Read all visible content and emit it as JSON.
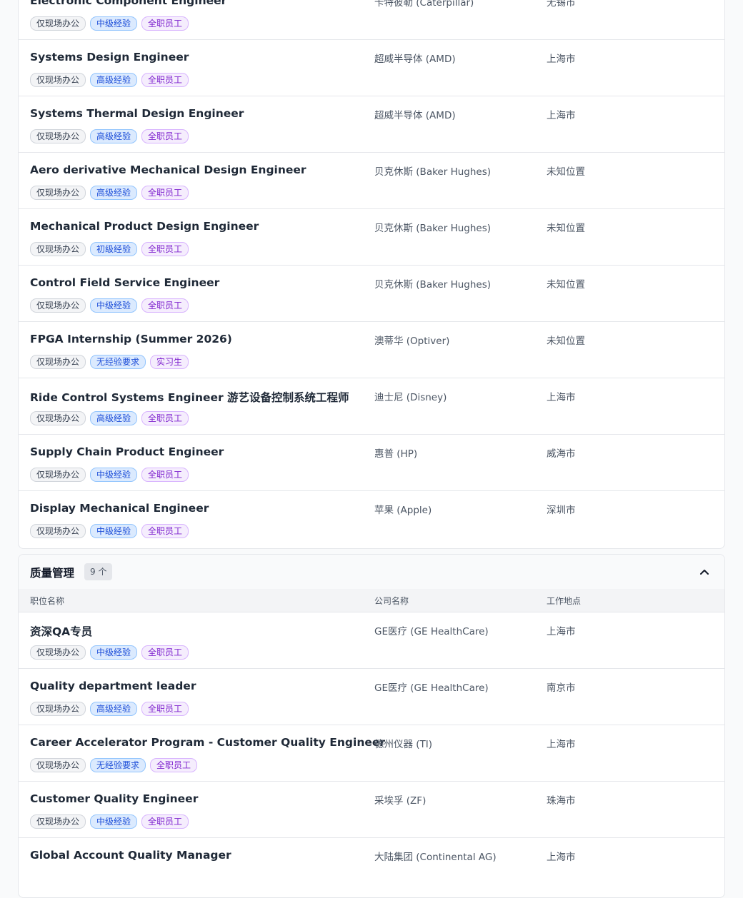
{
  "section_1": {
    "rows": [
      {
        "title": "Electronic Component Engineer",
        "company": "卡特彼勒 (Caterpillar)",
        "location": "无锡市",
        "tags": [
          "仅现场办公",
          "中级经验",
          "全职员工"
        ]
      },
      {
        "title": "Systems Design Engineer",
        "company": "超威半导体 (AMD)",
        "location": "上海市",
        "tags": [
          "仅现场办公",
          "高级经验",
          "全职员工"
        ]
      },
      {
        "title": "Systems Thermal Design Engineer",
        "company": "超威半导体 (AMD)",
        "location": "上海市",
        "tags": [
          "仅现场办公",
          "高级经验",
          "全职员工"
        ]
      },
      {
        "title": "Aero derivative Mechanical Design Engineer",
        "company": "贝克休斯 (Baker Hughes)",
        "location": "未知位置",
        "tags": [
          "仅现场办公",
          "高级经验",
          "全职员工"
        ]
      },
      {
        "title": "Mechanical Product Design Engineer",
        "company": "贝克休斯 (Baker Hughes)",
        "location": "未知位置",
        "tags": [
          "仅现场办公",
          "初级经验",
          "全职员工"
        ]
      },
      {
        "title": "Control Field Service Engineer",
        "company": "贝克休斯 (Baker Hughes)",
        "location": "未知位置",
        "tags": [
          "仅现场办公",
          "中级经验",
          "全职员工"
        ]
      },
      {
        "title": "FPGA Internship (Summer 2026)",
        "company": "澳蒂华 (Optiver)",
        "location": "未知位置",
        "tags": [
          "仅现场办公",
          "无经验要求",
          "实习生"
        ]
      },
      {
        "title": "Ride Control Systems Engineer 游艺设备控制系统工程师",
        "company": "迪士尼 (Disney)",
        "location": "上海市",
        "tags": [
          "仅现场办公",
          "高级经验",
          "全职员工"
        ]
      },
      {
        "title": "Supply Chain Product Engineer",
        "company": "惠普 (HP)",
        "location": "威海市",
        "tags": [
          "仅现场办公",
          "中级经验",
          "全职员工"
        ]
      },
      {
        "title": "Display Mechanical Engineer",
        "company": "苹果 (Apple)",
        "location": "深圳市",
        "tags": [
          "仅现场办公",
          "中级经验",
          "全职员工"
        ]
      }
    ]
  },
  "section_2": {
    "title": "质量管理",
    "count": "9 个",
    "columns": {
      "position": "职位名称",
      "company": "公司名称",
      "location": "工作地点"
    },
    "rows": [
      {
        "title": "资深QA专员",
        "company": "GE医疗 (GE HealthCare)",
        "location": "上海市",
        "tags": [
          "仅现场办公",
          "中级经验",
          "全职员工"
        ]
      },
      {
        "title": "Quality department leader",
        "company": "GE医疗 (GE HealthCare)",
        "location": "南京市",
        "tags": [
          "仅现场办公",
          "高级经验",
          "全职员工"
        ]
      },
      {
        "title": "Career Accelerator Program - Customer Quality Engineer",
        "company": "德州仪器 (TI)",
        "location": "上海市",
        "tags": [
          "仅现场办公",
          "无经验要求",
          "全职员工"
        ]
      },
      {
        "title": "Customer Quality Engineer",
        "company": "采埃孚 (ZF)",
        "location": "珠海市",
        "tags": [
          "仅现场办公",
          "中级经验",
          "全职员工"
        ]
      },
      {
        "title": "Global Account Quality Manager",
        "company": "大陆集团 (Continental AG)",
        "location": "上海市",
        "tags": []
      }
    ]
  },
  "icons": {
    "collapse": "chevron-up-icon"
  },
  "colors": {
    "accent_blue": "#1d4ed8",
    "accent_purple": "#7e22ce",
    "border": "#e5e7eb"
  }
}
